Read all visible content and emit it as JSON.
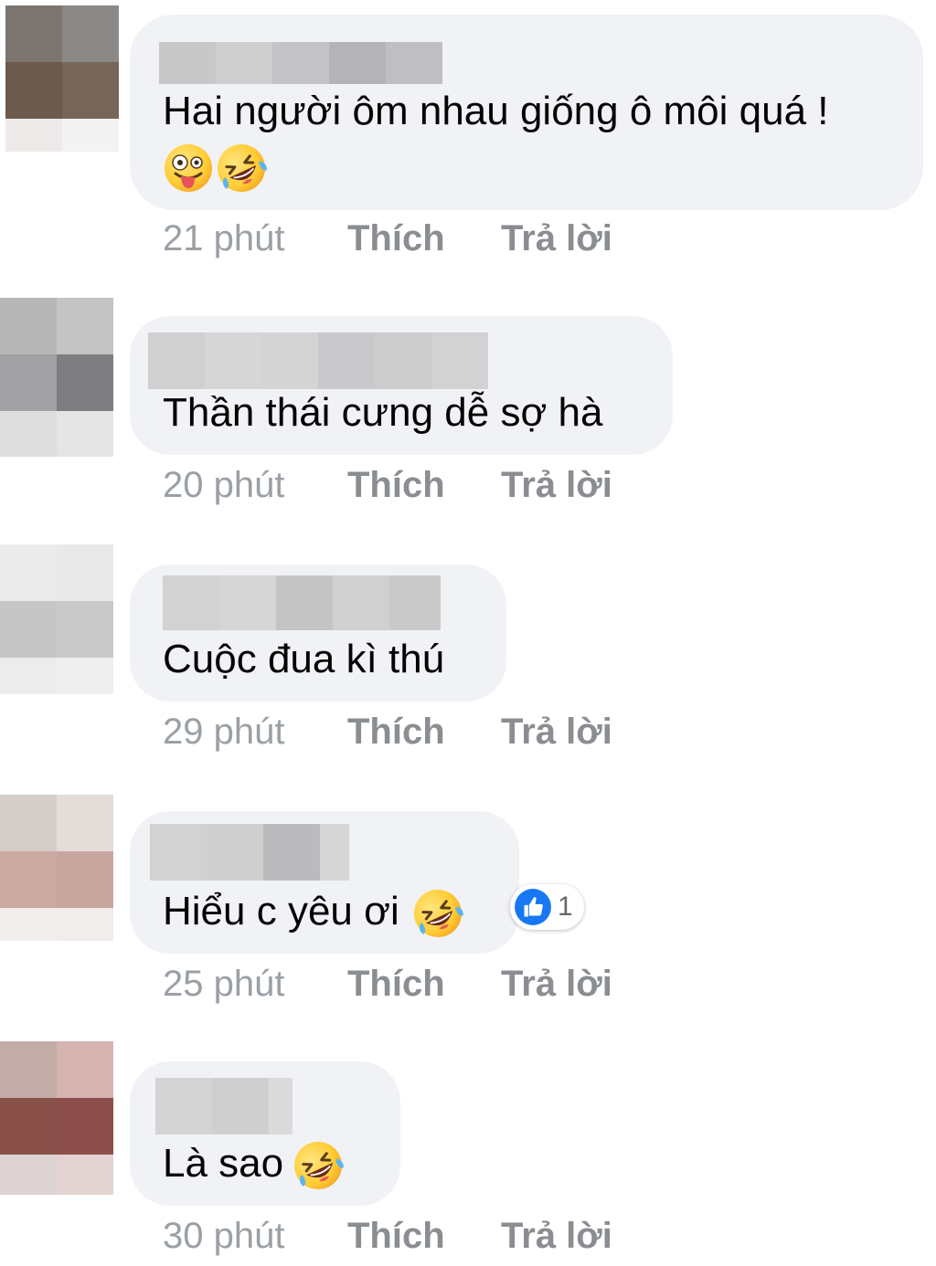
{
  "colors": {
    "bubble_bg": "#f0f2f5",
    "comment_text": "#050505",
    "meta_text": "#8a8d91",
    "like_blue": "#1877f2"
  },
  "comments": [
    {
      "author": "",
      "text": "Hai người ôm nhau giống ô môi quá !",
      "emojis": [
        "zany-face-icon",
        "rolling-laughing-icon"
      ],
      "time": "21 phút",
      "like": "Thích",
      "reply": "Trả lời"
    },
    {
      "author": "",
      "text": "Thần thái cưng dễ sợ hà",
      "time": "20 phút",
      "like": "Thích",
      "reply": "Trả lời"
    },
    {
      "author": "",
      "text": "Cuộc đua kì thú",
      "time": "29 phút",
      "like": "Thích",
      "reply": "Trả lời"
    },
    {
      "author": "",
      "text": "Hiểu c yêu ơi",
      "emojis": [
        "rolling-laughing-icon"
      ],
      "reaction": {
        "icon": "thumbs-up-icon",
        "count": "1"
      },
      "time": "25 phút",
      "like": "Thích",
      "reply": "Trả lời"
    },
    {
      "author": "",
      "text": "Là sao",
      "emojis": [
        "rolling-laughing-icon"
      ],
      "time": "30 phút",
      "like": "Thích",
      "reply": "Trả lời"
    }
  ]
}
